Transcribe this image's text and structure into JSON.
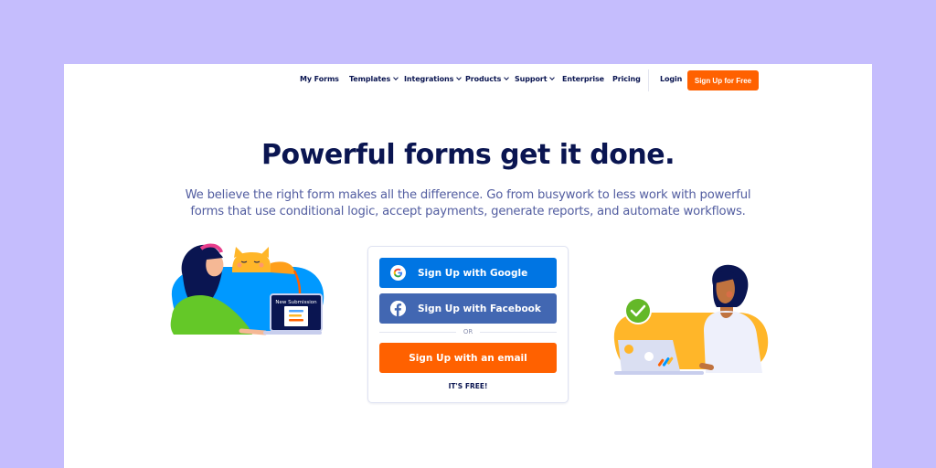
{
  "nav": {
    "items": [
      {
        "label": "My Forms",
        "dropdown": false
      },
      {
        "label": "Templates",
        "dropdown": true
      },
      {
        "label": "Integrations",
        "dropdown": true
      },
      {
        "label": "Products",
        "dropdown": true
      },
      {
        "label": "Support",
        "dropdown": true
      },
      {
        "label": "Enterprise",
        "dropdown": false
      },
      {
        "label": "Pricing",
        "dropdown": false
      }
    ],
    "login": "Login",
    "signup": "Sign Up for Free"
  },
  "hero": {
    "title": "Powerful forms get it done.",
    "subtitle_line1": "We believe the right form makes all the difference. Go from busywork to less work with powerful",
    "subtitle_line2": "forms that use conditional logic, accept payments, generate reports, and automate workflows."
  },
  "signup_card": {
    "google": "Sign Up with Google",
    "facebook": "Sign Up with Facebook",
    "or": "OR",
    "email": "Sign Up with an email",
    "free_note": "IT'S FREE!"
  },
  "illustrations": {
    "left_laptop_label": "New Submission"
  },
  "colors": {
    "background": "#c5bdfd",
    "navy": "#0a1551",
    "orange": "#ff6100",
    "google_blue": "#0075e3",
    "facebook_blue": "#4267b2",
    "subtitle": "#525da0"
  }
}
